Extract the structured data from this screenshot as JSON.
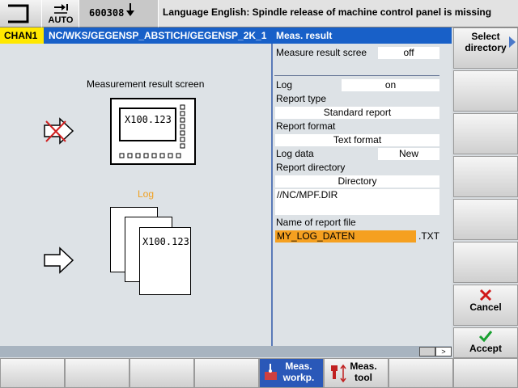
{
  "header": {
    "mode_label": "AUTO",
    "program_value": "600308",
    "message": "Language English: Spindle release of machine control panel is missing"
  },
  "titlebar": {
    "channel": "CHAN1",
    "path": "NC/WKS/GEGENSP_ABSTICH/GEGENSP_2K_1",
    "panel_title": "Meas. result"
  },
  "illustration": {
    "screen_title": "Measurement result screen",
    "screen_value": "X100.123",
    "log_title": "Log",
    "log_value": "X100.123"
  },
  "form": {
    "measure_result_screen_label": "Measure result scree",
    "measure_result_screen_value": "off",
    "log_label": "Log",
    "log_value": "on",
    "report_type_label": "Report type",
    "report_type_value": "Standard report",
    "report_format_label": "Report format",
    "report_format_value": "Text format",
    "log_data_label": "Log data",
    "log_data_value": "New",
    "report_directory_label": "Report directory",
    "report_directory_value": "Directory",
    "report_path_value": "//NC/MPF.DIR",
    "report_file_label": "Name of report file",
    "report_file_value": "MY_LOG_DATEN",
    "report_file_ext": ".TXT"
  },
  "scroll": {
    "right_arrow": ">"
  },
  "vertical_softkeys": {
    "select_directory_line1": "Select",
    "select_directory_line2": "directory",
    "cancel_label": "Cancel",
    "accept_label": "Accept"
  },
  "horizontal_softkeys": {
    "meas_workp_line1": "Meas.",
    "meas_workp_line2": "workp.",
    "meas_tool_line1": "Meas.",
    "meas_tool_line2": "tool"
  },
  "colors": {
    "title_bar": "#1860c8",
    "channel_bg": "#ffe800",
    "log_title": "#f0a020",
    "file_highlight": "#f5a020",
    "cancel_icon": "#d01818",
    "accept_icon": "#18a030",
    "cross_mark": "#d02020",
    "active_softkey": "#2a58b8"
  }
}
